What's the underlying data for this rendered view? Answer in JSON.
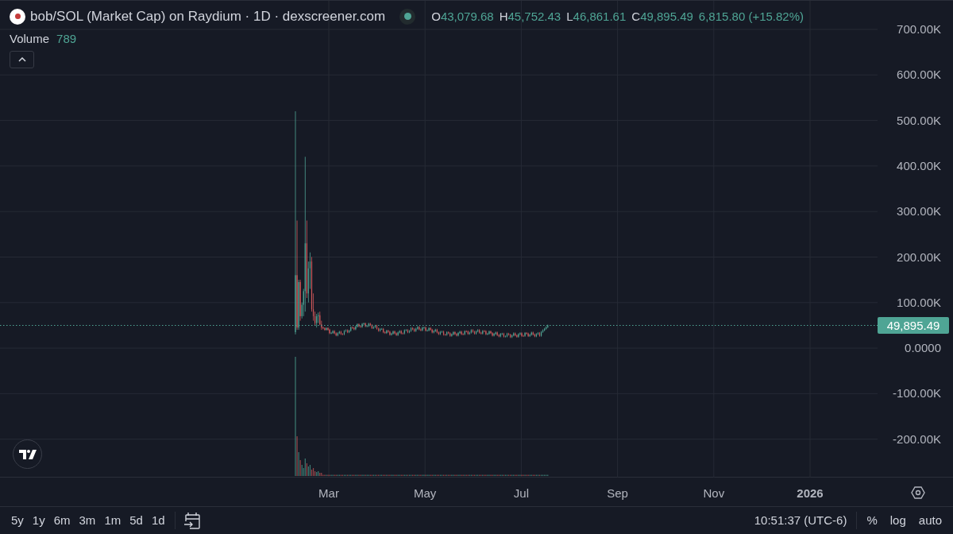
{
  "header": {
    "title": "bob/SOL (Market Cap) on Raydium · 1D · dexscreener.com",
    "live": true,
    "ohlc": [
      {
        "label": "O",
        "value": "43,079.68"
      },
      {
        "label": "H",
        "value": "45,752.43"
      },
      {
        "label": "L",
        "value": "46,861.61"
      },
      {
        "label": "C",
        "value": "49,895.49"
      }
    ],
    "change": "6,815.80 (+15.82%)"
  },
  "volume": {
    "label": "Volume",
    "value": "789"
  },
  "chart": {
    "y_labels": [
      "700.00K",
      "600.00K",
      "500.00K",
      "400.00K",
      "300.00K",
      "200.00K",
      "100.00K",
      "0.0000",
      "-100.00K",
      "-200.00K"
    ],
    "x_labels": [
      {
        "text": "Mar",
        "bold": false
      },
      {
        "text": "May",
        "bold": false
      },
      {
        "text": "Jul",
        "bold": false
      },
      {
        "text": "Sep",
        "bold": false
      },
      {
        "text": "Nov",
        "bold": false
      },
      {
        "text": "2026",
        "bold": true
      }
    ],
    "last_price": "49,895.49"
  },
  "toolbar": {
    "ranges": [
      "5y",
      "1y",
      "6m",
      "3m",
      "1m",
      "5d",
      "1d"
    ],
    "time": "10:51:37 (UTC-6)",
    "options": [
      "%",
      "log",
      "auto"
    ]
  }
}
